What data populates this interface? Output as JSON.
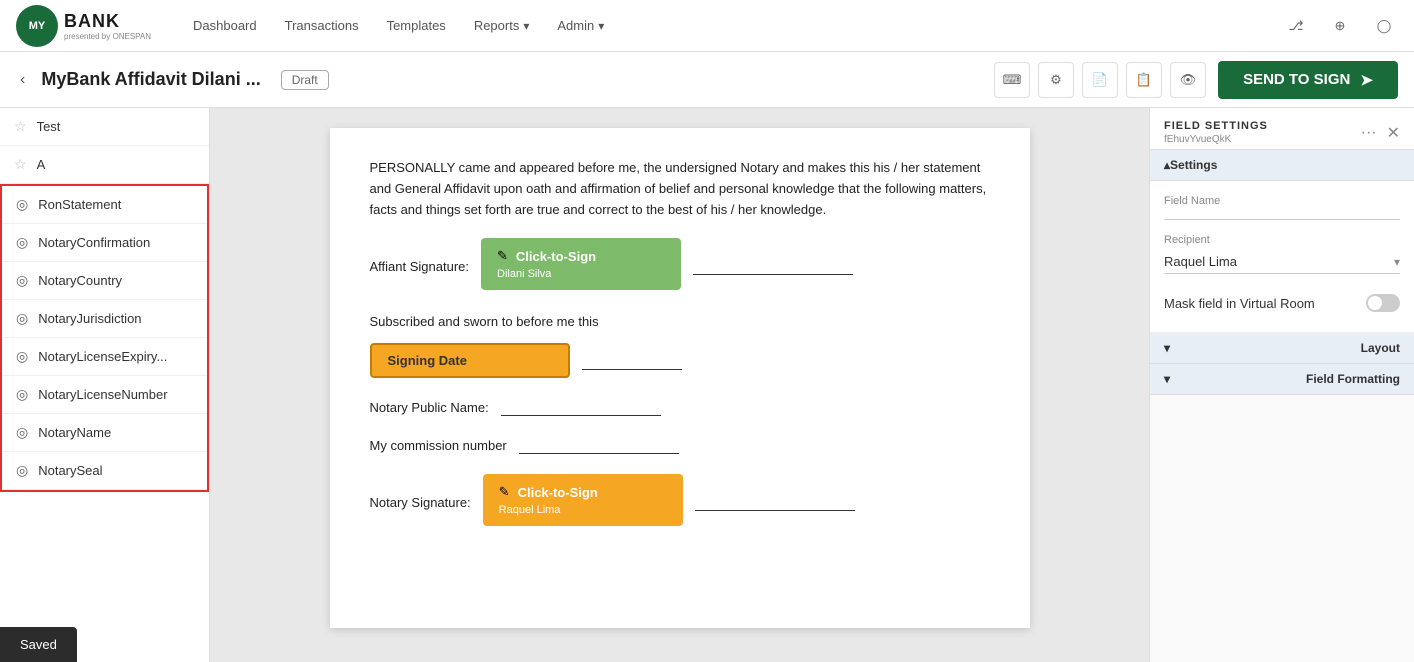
{
  "app": {
    "logo_text": "MY",
    "logo_bank": "BANK",
    "logo_sub": "presented by ONESPAN"
  },
  "nav": {
    "dashboard": "Dashboard",
    "transactions": "Transactions",
    "templates": "Templates",
    "reports": "Reports",
    "admin": "Admin"
  },
  "toolbar": {
    "back_label": "‹",
    "doc_title": "MyBank Affidavit Dilani ...",
    "draft_label": "Draft",
    "send_label": "SEND TO SIGN"
  },
  "sidebar": {
    "top_items": [
      {
        "id": "test",
        "label": "Test",
        "icon": "star"
      },
      {
        "id": "a",
        "label": "A",
        "icon": "star"
      }
    ],
    "notary_items": [
      {
        "id": "ron-statement",
        "label": "RonStatement"
      },
      {
        "id": "notary-confirmation",
        "label": "NotaryConfirmation"
      },
      {
        "id": "notary-country",
        "label": "NotaryCountry"
      },
      {
        "id": "notary-jurisdiction",
        "label": "NotaryJurisdiction"
      },
      {
        "id": "notary-license-expiry",
        "label": "NotaryLicenseExpiry..."
      },
      {
        "id": "notary-license-number",
        "label": "NotaryLicenseNumber"
      },
      {
        "id": "notary-name",
        "label": "NotaryName"
      },
      {
        "id": "notary-seal",
        "label": "NotarySeal"
      }
    ]
  },
  "document": {
    "intro_text": "PERSONALLY came and appeared before me, the undersigned Notary and makes this his / her statement and General Affidavit upon oath and affirmation of belief and personal knowledge that the following matters, facts and things set forth are true and correct to the best of his / her knowledge.",
    "affiant_label": "Affiant Signature:",
    "sign_block_1_label": "Click-to-Sign",
    "sign_block_1_sub": "Dilani Silva",
    "sworn_label": "Subscribed and sworn to before me this",
    "date_field_label": "Signing Date",
    "notary_public_label": "Notary Public Name:",
    "commission_label": "My commission number",
    "notary_sig_label": "Notary Signature:",
    "sign_block_2_label": "Click-to-Sign",
    "sign_block_2_sub": "Raquel Lima"
  },
  "field_settings": {
    "title": "FIELD SETTINGS",
    "field_id": "fEhuvYvueQkK",
    "settings_label": "Settings",
    "layout_label": "Layout",
    "formatting_label": "Field Formatting",
    "field_name_label": "Field Name",
    "field_name_value": "",
    "recipient_label": "Recipient",
    "recipient_value": "Raquel Lima",
    "mask_label": "Mask field in Virtual Room",
    "mask_toggle": false
  },
  "toast": {
    "label": "Saved"
  },
  "icons": {
    "search": "⌨",
    "gear": "⚙",
    "doc1": "📄",
    "doc2": "📋",
    "eye": "👁",
    "close": "✕",
    "menu": "···",
    "chevron_down": "▾",
    "chevron_up": "▴",
    "chevron_left": "‹",
    "send_arrow": "➤",
    "notary": "◎",
    "star": "☆",
    "pencil": "✎",
    "network": "⎇",
    "globe": "◉",
    "user": "◯"
  }
}
